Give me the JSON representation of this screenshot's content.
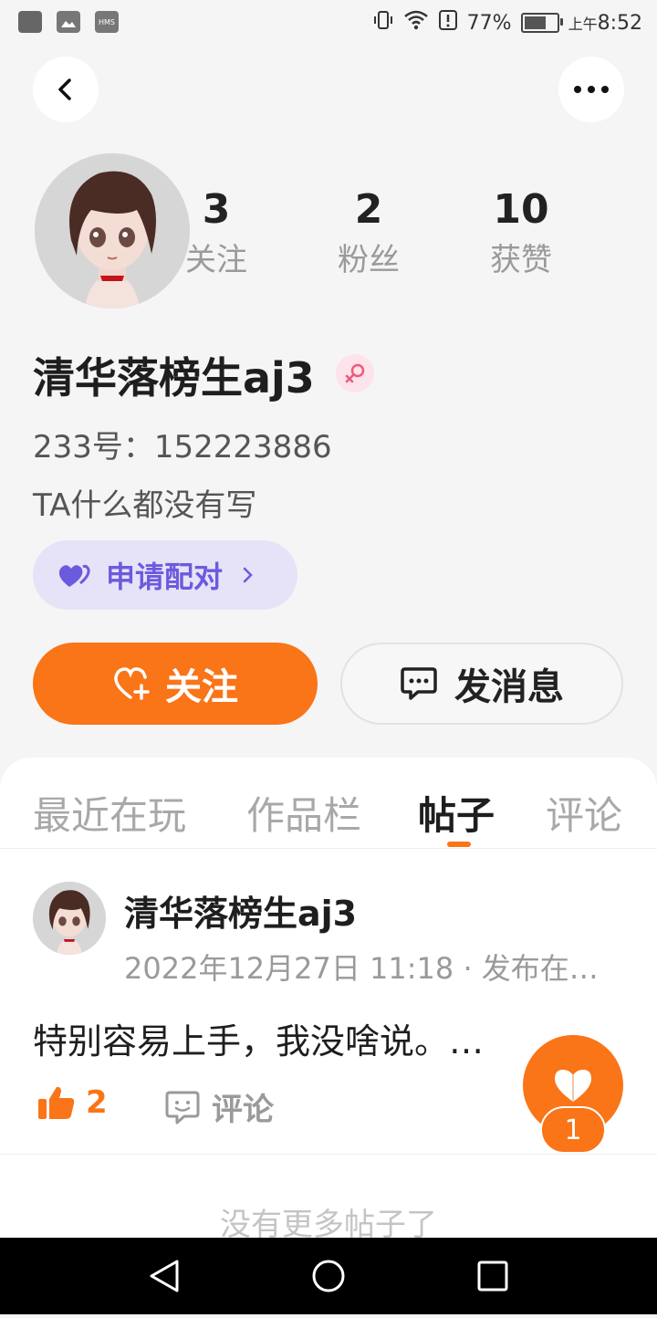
{
  "status_bar": {
    "battery": "77%",
    "time_prefix": "上午",
    "time": "8:52",
    "hms_label": "HMS",
    "battery_level": 0.77
  },
  "header": {
    "back_icon": "chevron-left-icon",
    "more_icon": "more-horizontal-icon"
  },
  "profile": {
    "name": "清华落榜生aj3",
    "gender_icon": "female-icon",
    "uid": "233号：152223886",
    "bio": "TA什么都没有写",
    "stats": [
      {
        "value": "3",
        "label": "关注"
      },
      {
        "value": "2",
        "label": "粉丝"
      },
      {
        "value": "10",
        "label": "获赞"
      }
    ],
    "pair_button": "申请配对",
    "follow_button": "关注",
    "message_button": "发消息"
  },
  "tabs": [
    {
      "label": "最近在玩"
    },
    {
      "label": "作品栏"
    },
    {
      "label": "帖子"
    },
    {
      "label": "评论"
    }
  ],
  "post": {
    "author": "清华落榜生aj3",
    "meta": "2022年12月27日 11:18 · 发布在…",
    "text": "特别容易上手，我没啥说。…",
    "likes": "2",
    "comment_label": "评论"
  },
  "no_more_text": "没有更多帖子了",
  "fab": {
    "badge": "1",
    "icon": "heart-icon"
  },
  "colors": {
    "accent": "#fa7418",
    "pair": "#6b5bdc",
    "pair_bg": "#e6e2f8"
  }
}
